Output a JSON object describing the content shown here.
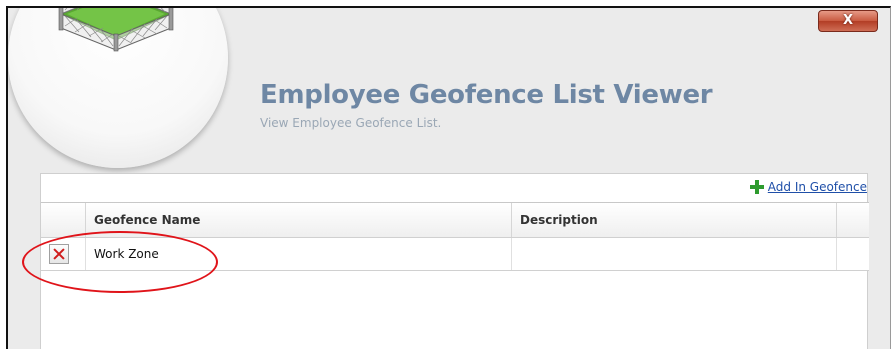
{
  "window": {
    "close_label": "X"
  },
  "header": {
    "title": "Employee Geofence List Viewer",
    "subtitle": "View Employee Geofence List.",
    "logo_icon": "fenced-grass-icon",
    "title_color": "#6e87a4"
  },
  "toolbar": {
    "add_label": "Add In Geofence",
    "add_icon": "plus-icon"
  },
  "grid": {
    "columns": [
      "Geofence Name",
      "Description"
    ],
    "rows": [
      {
        "name": "Work Zone",
        "description": "",
        "action_icon": "delete-x-icon"
      }
    ]
  },
  "colors": {
    "accent": "#e0141a",
    "link": "#1f4fa8",
    "add_icon": "#2e9b2e",
    "close_button": "#c95a40"
  }
}
